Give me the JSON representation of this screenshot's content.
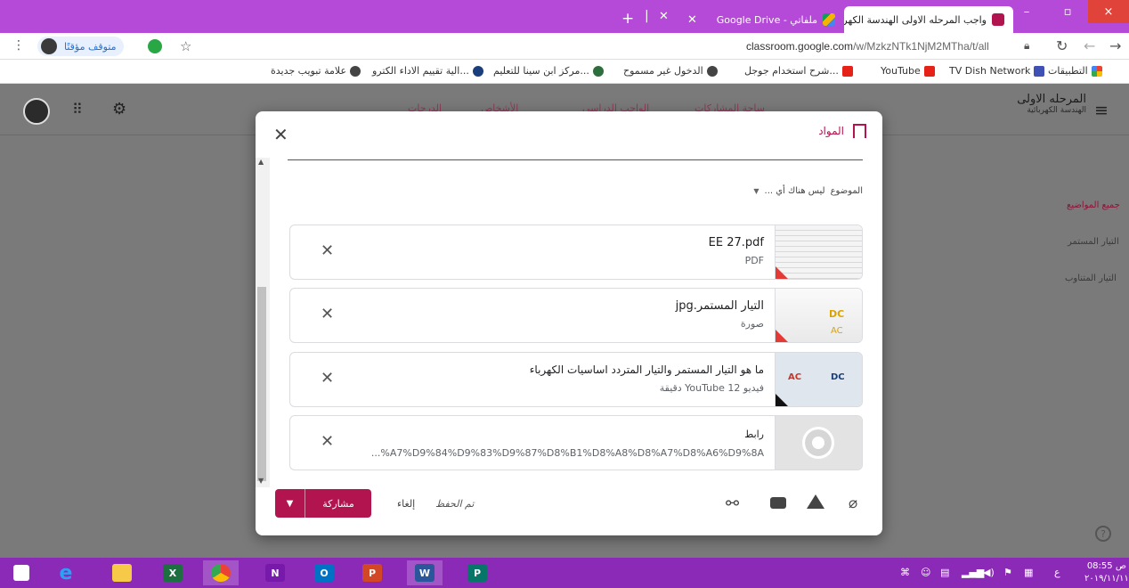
{
  "browser": {
    "tabs": [
      {
        "title": "واجب المرحله الاولى الهندسة الكهربائية",
        "active": true
      },
      {
        "title": "ملفاتي - Google Drive",
        "active": false
      }
    ],
    "window_controls": [
      "–",
      "▫",
      "×"
    ],
    "url_host": "classroom.google.com",
    "url_path": "/w/MzkzNTk1NjM2MTha/t/all",
    "profile_label": "متوقف مؤقتًا",
    "bookmarks": [
      {
        "label": "التطبيقات",
        "icon": "apps-grid-icon"
      },
      {
        "label": "TV Dish Network",
        "icon": "bookmark-favicon"
      },
      {
        "label": "YouTube",
        "icon": "youtube-icon"
      },
      {
        "label": "شرح استخدام جوجل...",
        "icon": "youtube-icon"
      },
      {
        "label": "الدخول غير مسموح",
        "icon": "globe-icon"
      },
      {
        "label": "مركز ابن سينا للتعليم...",
        "icon": "bookmark-favicon"
      },
      {
        "label": "الية تقييم الاداء الكترو...",
        "icon": "bookmark-favicon"
      },
      {
        "label": "علامة تبويب جديدة",
        "icon": "globe-icon"
      }
    ]
  },
  "classroom": {
    "class_name": "المرحله الاولى",
    "class_section": "الهندسة الكهربائية",
    "nav_tabs": [
      "ساحة المشاركات",
      "الواجب الدراسي",
      "الأشخاص",
      "الدرجات"
    ],
    "topics": [
      "جميع المواضيع",
      "التيار المستمر",
      "التيار المتناوب"
    ]
  },
  "dialog": {
    "title": "المواد",
    "topic_label": "الموضوع",
    "topic_value": "ليس هناك أي ...",
    "attachments": [
      {
        "title": "EE 27.pdf",
        "subtitle": "PDF",
        "kind": "pdf"
      },
      {
        "title": "التيار المستمر.jpg",
        "subtitle": "صورة",
        "kind": "image"
      },
      {
        "title": "ما هو التيار المستمر والتيار المتردد اساسيات الكهرباء",
        "subtitle": "فيديو YouTube  12 دقيقة",
        "kind": "video"
      },
      {
        "title": "رابط",
        "subtitle": "...%A7%D9%84%D9%83%D9%87%D8%B1%D8%A8%D8%A7%D8%A6%D9%8A",
        "kind": "link"
      }
    ],
    "share_label": "مشاركة",
    "cancel_label": "إلغاء",
    "saved_label": "تم الحفظ"
  },
  "taskbar": {
    "clock_time": "08:55 ص",
    "clock_date": "٢٠١٩/١١/١١",
    "lang": "ع"
  },
  "colors": {
    "accent": "#b1144e",
    "tabbar": "#b64ad8",
    "taskbar": "#8c2ab8"
  }
}
